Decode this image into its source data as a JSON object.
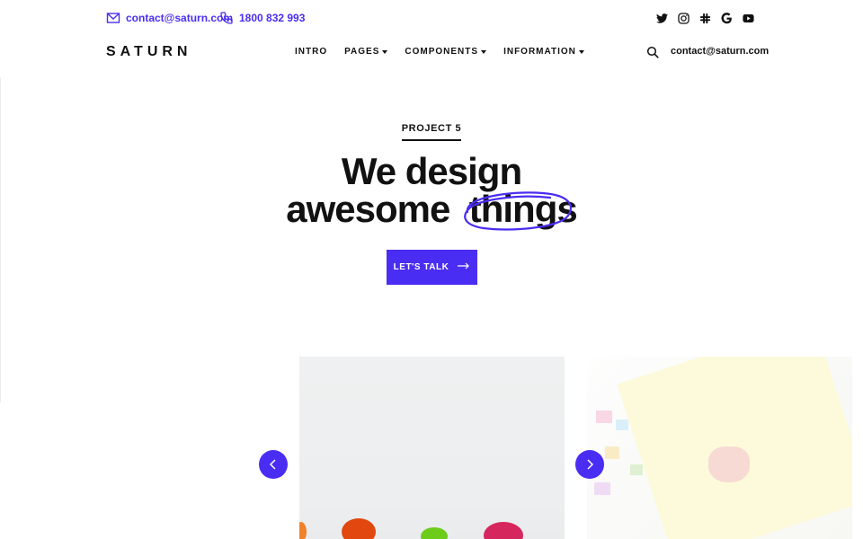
{
  "topbar": {
    "email": "contact@saturn.com",
    "phone": "1800 832 993",
    "socials": [
      "twitter-icon",
      "instagram-icon",
      "slack-icon",
      "google-icon",
      "youtube-icon"
    ]
  },
  "nav": {
    "brand": "SATURN",
    "items": [
      {
        "label": "INTRO",
        "dropdown": false
      },
      {
        "label": "PAGES",
        "dropdown": true
      },
      {
        "label": "COMPONENTS",
        "dropdown": true
      },
      {
        "label": "INFORMATION",
        "dropdown": true
      }
    ],
    "email": "contact@saturn.com"
  },
  "hero": {
    "eyebrow": "PROJECT 5",
    "line1": "We design",
    "line2_pre": "awesome",
    "line2_highlight": "things",
    "cta_label": "LET'S TALK"
  },
  "colors": {
    "accent": "#4a2df2",
    "text": "#111111"
  }
}
